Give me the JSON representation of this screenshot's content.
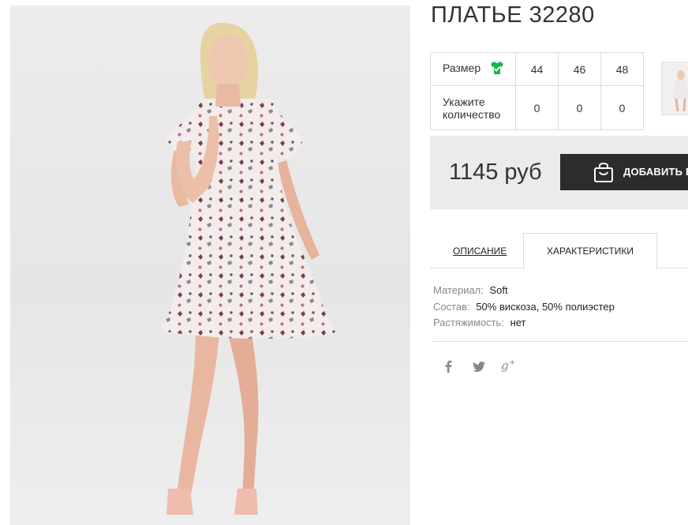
{
  "product": {
    "title": "ПЛАТЬЕ 32280",
    "price": "1145 руб",
    "add_to_cart_label": "ДОБАВИТЬ В"
  },
  "size_table": {
    "size_label": "Размер",
    "quantity_label": "Укажите количество",
    "sizes": [
      "44",
      "46",
      "48"
    ],
    "quantities": [
      "0",
      "0",
      "0"
    ]
  },
  "tabs": {
    "description": "ОПИСАНИЕ",
    "characteristics": "ХАРАКТЕРИСТИКИ",
    "active": "characteristics"
  },
  "specs": [
    {
      "label": "Материал:",
      "value": "Soft"
    },
    {
      "label": "Состав:",
      "value": "50% вискоза, 50% полиэстер"
    },
    {
      "label": "Растяжимость:",
      "value": "нет"
    }
  ],
  "social": [
    "facebook-icon",
    "twitter-icon",
    "google-plus-icon"
  ],
  "colors": {
    "button_bg": "#2c2c2c",
    "price_bg": "#ebebeb",
    "size_icon": "#19b84a"
  }
}
